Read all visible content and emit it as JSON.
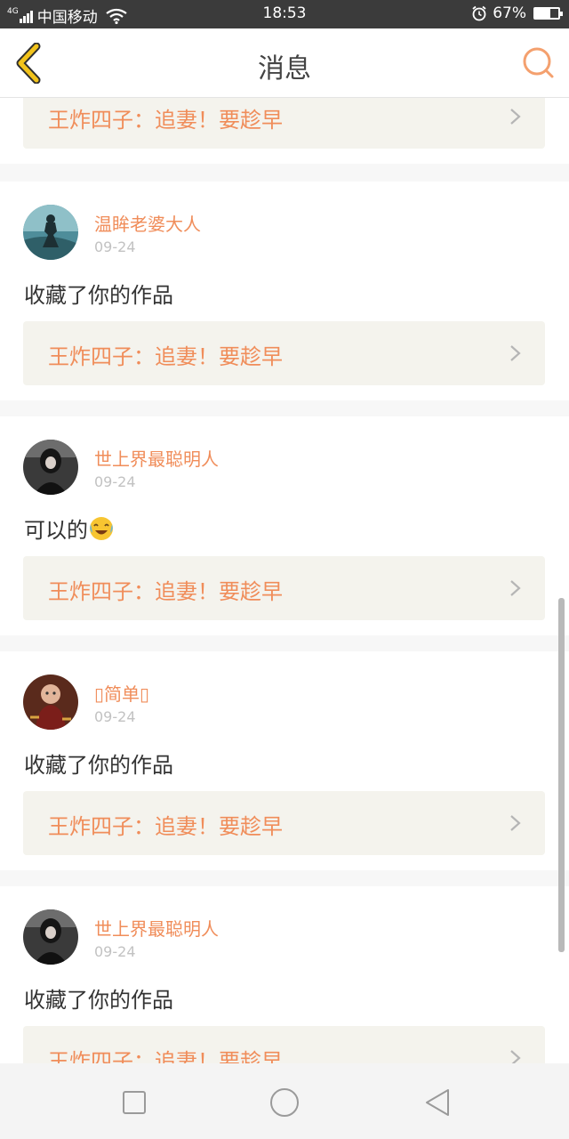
{
  "status_bar": {
    "network": "4G",
    "carrier": "中国移动",
    "time": "18:53",
    "battery": "67%",
    "battery_level": 0.67
  },
  "header": {
    "title": "消息",
    "back_icon": "chevron-left-icon",
    "search_icon": "search-icon"
  },
  "colors": {
    "accent": "#f08d5a",
    "back_icon": "#f2c31b",
    "card_link_bg": "#f4f3ed",
    "status_bar_bg": "#3b3b3b"
  },
  "messages": [
    {
      "work_title": "王炸四子：追妻！要趁早"
    },
    {
      "username": "温眸老婆大人",
      "date": "09-24",
      "comment": "收藏了你的作品",
      "work_title": "王炸四子：追妻！要趁早"
    },
    {
      "username": "世上界最聪明人",
      "date": "09-24",
      "comment": "可以的",
      "comment_emoji": "laughing-crying-emoji",
      "work_title": "王炸四子：追妻！要趁早"
    },
    {
      "username": "▯简单▯",
      "date": "09-24",
      "comment": "收藏了你的作品",
      "work_title": "王炸四子：追妻！要趁早"
    },
    {
      "username": "世上界最聪明人",
      "date": "09-24",
      "comment": "收藏了你的作品",
      "work_title": "王炸四子：追妻！要趁早"
    }
  ],
  "nav_bar": {
    "recent_icon": "square-icon",
    "home_icon": "circle-icon",
    "back_icon": "triangle-back-icon"
  }
}
